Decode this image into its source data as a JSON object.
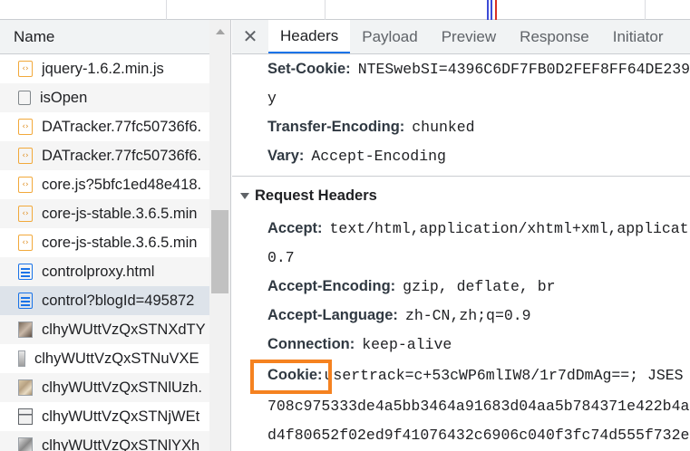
{
  "name_column": {
    "header": "Name"
  },
  "requests": [
    {
      "name": "jquery-1.6.2.min.js",
      "icon": "script-icon",
      "type": "js"
    },
    {
      "name": "isOpen",
      "icon": "blank-file-icon",
      "type": "blank"
    },
    {
      "name": "DATracker.77fc50736f6.",
      "icon": "script-icon",
      "type": "js"
    },
    {
      "name": "DATracker.77fc50736f6.",
      "icon": "script-icon",
      "type": "js"
    },
    {
      "name": "core.js?5bfc1ed48e418.",
      "icon": "script-icon",
      "type": "js"
    },
    {
      "name": "core-js-stable.3.6.5.min",
      "icon": "script-icon",
      "type": "js"
    },
    {
      "name": "core-js-stable.3.6.5.min",
      "icon": "script-icon",
      "type": "js"
    },
    {
      "name": "controlproxy.html",
      "icon": "document-icon",
      "type": "doc"
    },
    {
      "name": "control?blogId=495872",
      "icon": "document-icon",
      "type": "doc"
    },
    {
      "name": "clhyWUttVzQxSTNXdTY",
      "icon": "image-thumbnail-icon",
      "type": "img"
    },
    {
      "name": "clhyWUttVzQxSTNuVXE",
      "icon": "image-thumbnail-icon",
      "type": "img2"
    },
    {
      "name": "clhyWUttVzQxSTNlUzh.",
      "icon": "image-thumbnail-icon",
      "type": "img3"
    },
    {
      "name": "clhyWUttVzQxSTNjWEt",
      "icon": "image-thumbnail-icon",
      "type": "img4"
    },
    {
      "name": "clhyWUttVzQxSTNlYXh",
      "icon": "image-thumbnail-icon",
      "type": "img5"
    }
  ],
  "tabs": {
    "close_icon": "close-icon",
    "items": [
      "Headers",
      "Payload",
      "Preview",
      "Response",
      "Initiator"
    ],
    "active": "Headers"
  },
  "response_headers": {
    "set_cookie": {
      "key": "Set-Cookie:",
      "value": "NTESwebSI=4396C6DF7FB0D2FEF8FF64DE239",
      "continuation": "y"
    },
    "transfer_encoding": {
      "key": "Transfer-Encoding:",
      "value": "chunked"
    },
    "vary": {
      "key": "Vary:",
      "value": "Accept-Encoding"
    }
  },
  "request_headers": {
    "title": "Request Headers",
    "accept": {
      "key": "Accept:",
      "value": "text/html,application/xhtml+xml,applicat",
      "continuation": "0.7"
    },
    "accept_encoding": {
      "key": "Accept-Encoding:",
      "value": "gzip, deflate, br"
    },
    "accept_language": {
      "key": "Accept-Language:",
      "value": "zh-CN,zh;q=0.9"
    },
    "connection": {
      "key": "Connection:",
      "value": "keep-alive"
    },
    "cookie": {
      "key": "Cookie:",
      "value": "usertrack=c+53cWP6mlIW8/1r7dDmAg==; JSES",
      "continuation1": "708c975333de4a5bb3464a91683d04aa5b784371e422b4a",
      "continuation2": "d4f80652f02ed9f41076432c6906c040f3fc74d555f732e"
    }
  },
  "colors": {
    "highlight_box": "#f58220",
    "tab_active_underline": "#1a73e8",
    "selected_row": "#dde3ea"
  }
}
